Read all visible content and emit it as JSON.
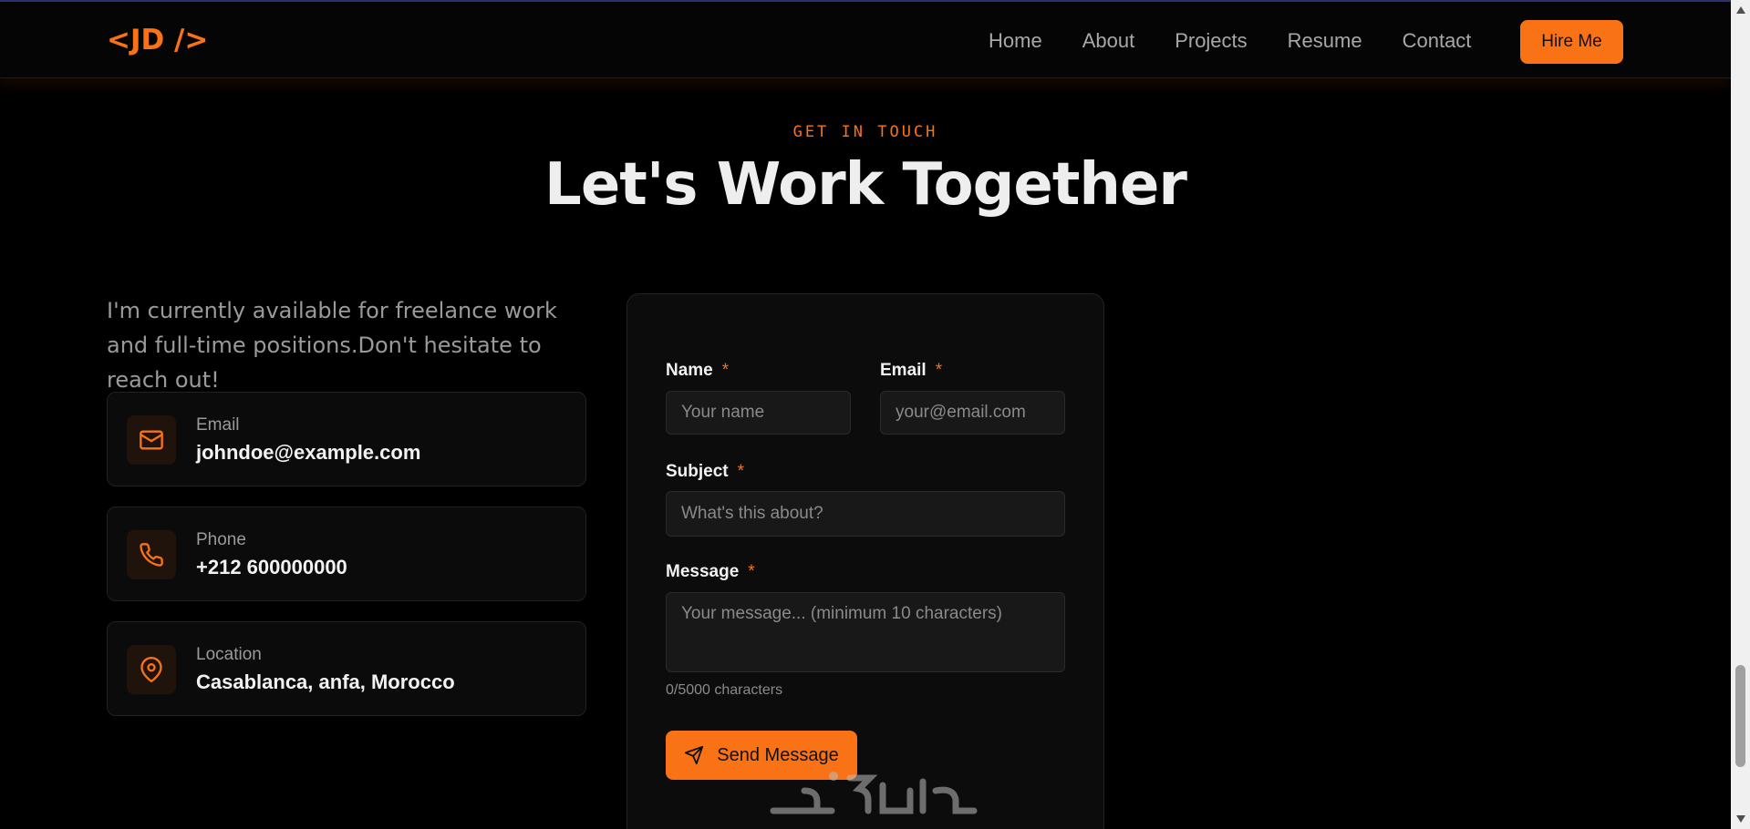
{
  "nav": {
    "logo": "<JD />",
    "links": [
      "Home",
      "About",
      "Projects",
      "Resume",
      "Contact"
    ],
    "hire_label": "Hire Me"
  },
  "header": {
    "eyebrow": "GET IN TOUCH",
    "title": "Let's Work Together"
  },
  "intro": "I'm currently available for freelance work and full-time positions.Don't hesitate to reach out!",
  "contacts": [
    {
      "label": "Email",
      "value": "johndoe@example.com",
      "icon": "mail-icon"
    },
    {
      "label": "Phone",
      "value": "+212 600000000",
      "icon": "phone-icon"
    },
    {
      "label": "Location",
      "value": "Casablanca, anfa, Morocco",
      "icon": "map-pin-icon"
    }
  ],
  "form": {
    "name_label": "Name",
    "name_placeholder": "Your name",
    "email_label": "Email",
    "email_placeholder": "your@email.com",
    "subject_label": "Subject",
    "subject_placeholder": "What's this about?",
    "message_label": "Message",
    "message_placeholder": "Your message... (minimum 10 characters)",
    "required_mark": "*",
    "char_count": "0/5000 characters",
    "send_label": "Send Message"
  },
  "colors": {
    "accent": "#f97316",
    "background": "#000000",
    "card": "#0b0b0b"
  }
}
